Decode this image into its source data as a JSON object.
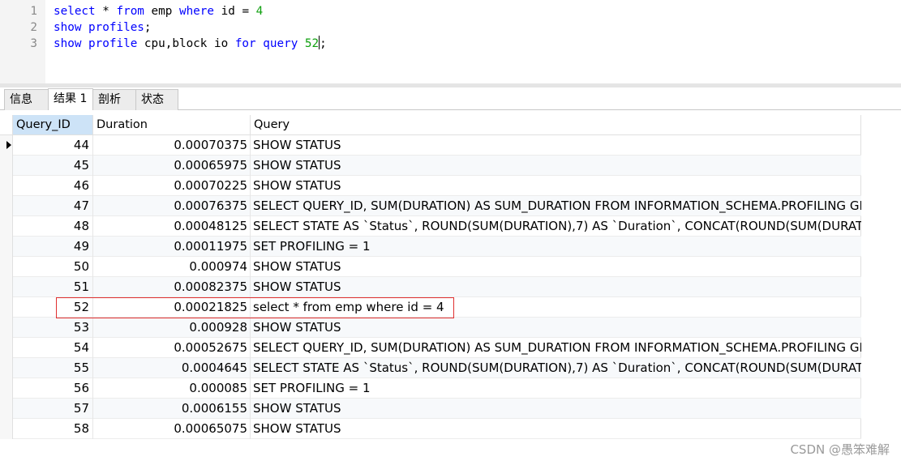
{
  "editor": {
    "lines": [
      {
        "num": "1",
        "tokens": [
          {
            "t": "select",
            "c": "kw"
          },
          {
            "t": " * ",
            "c": ""
          },
          {
            "t": "from",
            "c": "kw"
          },
          {
            "t": " emp ",
            "c": ""
          },
          {
            "t": "where",
            "c": "kw"
          },
          {
            "t": " id = ",
            "c": ""
          },
          {
            "t": "4",
            "c": "num"
          }
        ]
      },
      {
        "num": "2",
        "tokens": [
          {
            "t": "show",
            "c": "kw"
          },
          {
            "t": " ",
            "c": ""
          },
          {
            "t": "profiles",
            "c": "kw"
          },
          {
            "t": ";",
            "c": ""
          }
        ]
      },
      {
        "num": "3",
        "tokens": [
          {
            "t": "show",
            "c": "kw"
          },
          {
            "t": " ",
            "c": ""
          },
          {
            "t": "profile",
            "c": "kw"
          },
          {
            "t": " cpu,block io ",
            "c": ""
          },
          {
            "t": "for",
            "c": "kw"
          },
          {
            "t": " ",
            "c": ""
          },
          {
            "t": "query",
            "c": "kw"
          },
          {
            "t": " ",
            "c": ""
          },
          {
            "t": "52",
            "c": "num"
          },
          {
            "t": "|caret|",
            "c": "caret"
          },
          {
            "t": ";",
            "c": ""
          }
        ]
      }
    ]
  },
  "tabs": [
    {
      "label": "信息",
      "active": false
    },
    {
      "label": "结果 1",
      "active": true
    },
    {
      "label": "剖析",
      "active": false
    },
    {
      "label": "状态",
      "active": false
    }
  ],
  "grid": {
    "columns": [
      "Query_ID",
      "Duration",
      "Query"
    ],
    "rows": [
      {
        "id": "44",
        "duration": "0.00070375",
        "query": "SHOW STATUS"
      },
      {
        "id": "45",
        "duration": "0.00065975",
        "query": "SHOW STATUS"
      },
      {
        "id": "46",
        "duration": "0.00070225",
        "query": "SHOW STATUS"
      },
      {
        "id": "47",
        "duration": "0.00076375",
        "query": "SELECT QUERY_ID, SUM(DURATION) AS SUM_DURATION FROM INFORMATION_SCHEMA.PROFILING GR"
      },
      {
        "id": "48",
        "duration": "0.00048125",
        "query": "SELECT STATE AS `Status`, ROUND(SUM(DURATION),7) AS `Duration`, CONCAT(ROUND(SUM(DURATION"
      },
      {
        "id": "49",
        "duration": "0.00011975",
        "query": "SET PROFILING = 1"
      },
      {
        "id": "50",
        "duration": "0.000974",
        "query": "SHOW STATUS"
      },
      {
        "id": "51",
        "duration": "0.00082375",
        "query": "SHOW STATUS"
      },
      {
        "id": "52",
        "duration": "0.00021825",
        "query": "select * from emp where id = 4"
      },
      {
        "id": "53",
        "duration": "0.000928",
        "query": "SHOW STATUS"
      },
      {
        "id": "54",
        "duration": "0.00052675",
        "query": "SELECT QUERY_ID, SUM(DURATION) AS SUM_DURATION FROM INFORMATION_SCHEMA.PROFILING GR"
      },
      {
        "id": "55",
        "duration": "0.0004645",
        "query": "SELECT STATE AS `Status`, ROUND(SUM(DURATION),7) AS `Duration`, CONCAT(ROUND(SUM(DURATION"
      },
      {
        "id": "56",
        "duration": "0.000085",
        "query": "SET PROFILING = 1"
      },
      {
        "id": "57",
        "duration": "0.0006155",
        "query": "SHOW STATUS"
      },
      {
        "id": "58",
        "duration": "0.00065075",
        "query": "SHOW STATUS"
      }
    ]
  },
  "watermark": "CSDN @愚笨难解",
  "colors": {
    "keyword": "#0000ff",
    "number": "#10a010",
    "selected_header": "#cde3f7",
    "highlight": "#e03030"
  }
}
